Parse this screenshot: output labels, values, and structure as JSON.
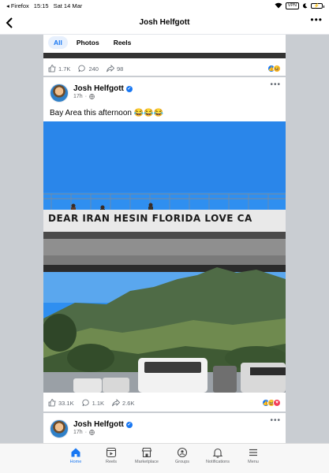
{
  "status_bar": {
    "back_app": "◂ Firefox",
    "time": "15:15",
    "date": "Sat 14 Mar",
    "vpn": "VPN",
    "battery": "⚡"
  },
  "nav": {
    "title": "Josh Helfgott"
  },
  "profile_tabs": [
    "All",
    "Photos",
    "Reels"
  ],
  "prev_post": {
    "likes": "1.7K",
    "comments": "240",
    "shares": "98"
  },
  "post": {
    "author": "Josh Helfgott",
    "time": "17h",
    "caption": "Bay Area this afternoon 😂😂😂",
    "banner_text": "DEAR IRAN HESIN FLORIDA LOVE CA",
    "likes": "33.1K",
    "comments": "1.1K",
    "shares": "2.6K"
  },
  "next_post": {
    "author": "Josh Helfgott",
    "time": "17h"
  },
  "tab_bar": [
    {
      "label": "Home",
      "icon": "home-icon"
    },
    {
      "label": "Reels",
      "icon": "reels-icon"
    },
    {
      "label": "Marketplace",
      "icon": "marketplace-icon"
    },
    {
      "label": "Groups",
      "icon": "groups-icon"
    },
    {
      "label": "Notifications",
      "icon": "bell-icon"
    },
    {
      "label": "Menu",
      "icon": "menu-icon"
    }
  ],
  "colors": {
    "accent": "#1877f2",
    "page_bg": "#c9cdd2"
  }
}
